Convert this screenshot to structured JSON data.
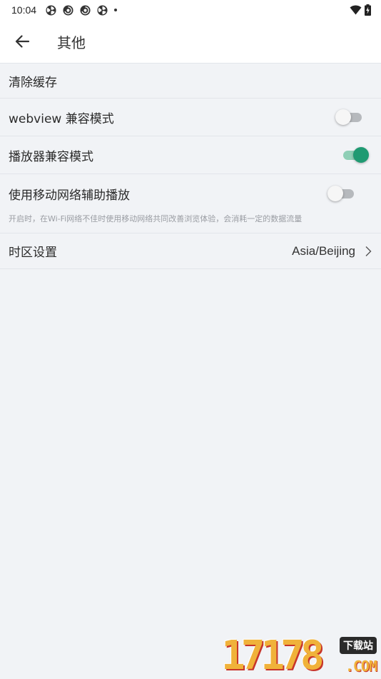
{
  "status_bar": {
    "time": "10:04",
    "left_icons": [
      "fan-icon",
      "chrome-icon",
      "chrome-icon",
      "fan-icon"
    ],
    "right_icons": [
      "wifi-icon",
      "battery-charging-icon"
    ]
  },
  "app_bar": {
    "back_icon": "arrow-left-icon",
    "title": "其他"
  },
  "settings": {
    "clear_cache": {
      "label": "清除缓存"
    },
    "webview_compat": {
      "label": "webview 兼容模式",
      "enabled": false
    },
    "player_compat": {
      "label": "播放器兼容模式",
      "enabled": true
    },
    "mobile_assist": {
      "label": "使用移动网络辅助播放",
      "description": "开启时，在Wi-Fi网络不佳时使用移动网络共同改善浏览体验，会消耗一定的数据流量",
      "enabled": false
    },
    "timezone": {
      "label": "时区设置",
      "value": "Asia/Beijing",
      "icon": "chevron-right-icon"
    }
  },
  "colors": {
    "accent": "#1f9a72",
    "accent_track": "#8fcfb6",
    "background": "#f1f3f6",
    "divider": "#e2e5ea"
  },
  "watermark": {
    "digits": "17178",
    "badge": "下载站",
    "suffix": ".COM"
  }
}
